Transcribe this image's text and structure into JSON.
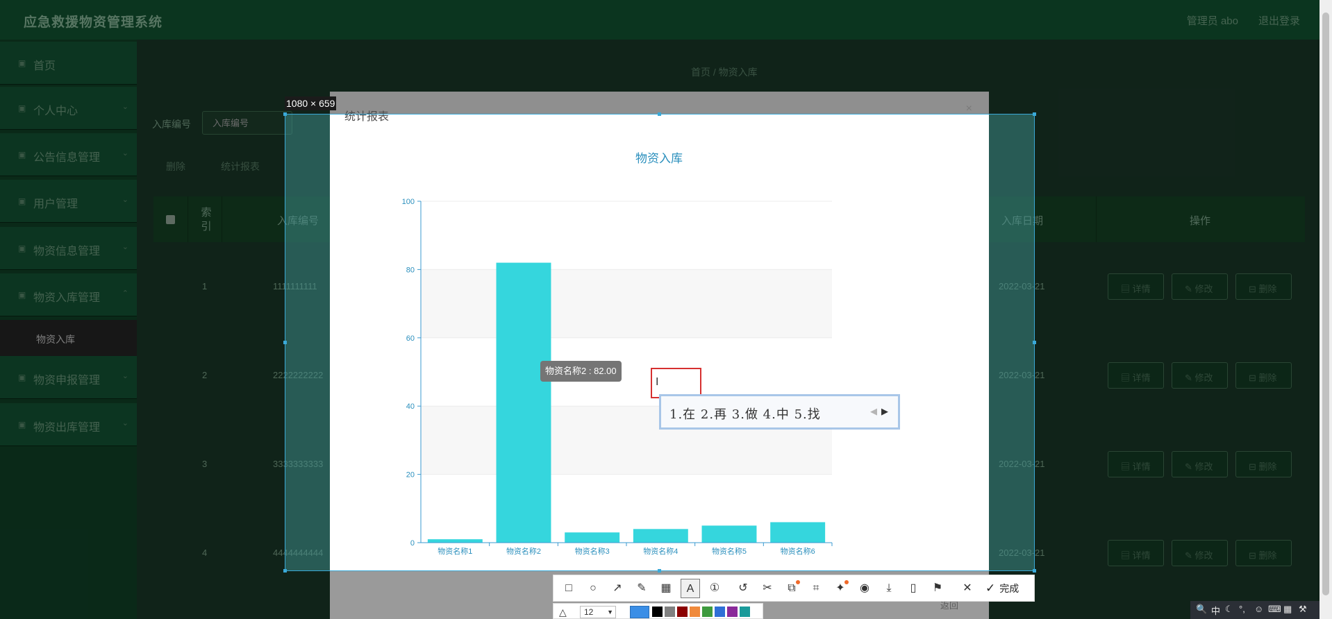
{
  "app": {
    "title": "应急救援物资管理系统",
    "user": "管理员 abo",
    "logout": "退出登录"
  },
  "sidebar": {
    "items": [
      {
        "label": "首页",
        "icon": "home-icon"
      },
      {
        "label": "个人中心",
        "icon": "user-icon"
      },
      {
        "label": "公告信息管理",
        "icon": "notice-icon"
      },
      {
        "label": "用户管理",
        "icon": "users-icon"
      },
      {
        "label": "物资信息管理",
        "icon": "box-icon"
      },
      {
        "label": "物资入库管理",
        "icon": "inbound-icon"
      },
      {
        "label": "物资申报管理",
        "icon": "apply-icon"
      },
      {
        "label": "物资出库管理",
        "icon": "outbound-icon"
      }
    ],
    "active_sub": "物资入库"
  },
  "breadcrumb": "首页 / 物资入库",
  "search": {
    "label": "入库编号",
    "placeholder": "入库编号"
  },
  "actions": {
    "delete": "删除",
    "stats": "统计报表"
  },
  "table": {
    "headers": {
      "index": "索引",
      "code": "入库编号",
      "date": "入库日期",
      "ops": "操作"
    },
    "rows": [
      {
        "index": "1",
        "code": "1111111111",
        "date": "2022-03-21"
      },
      {
        "index": "2",
        "code": "2222222222",
        "date": "2022-03-21"
      },
      {
        "index": "3",
        "code": "3333333333",
        "date": "2022-03-21"
      },
      {
        "index": "4",
        "code": "4444444444",
        "date": "2022-03-21"
      }
    ],
    "op_labels": {
      "detail": "详情",
      "edit": "修改",
      "remove": "删除"
    }
  },
  "modal": {
    "title": "统计报表",
    "close": "×",
    "return": "返回"
  },
  "capture": {
    "size_label": "1080 × 659",
    "done": "完成",
    "font_size": "12",
    "accent": "#3aa9d8",
    "current_color": "#3a8ee6",
    "swatches": [
      "#000000",
      "#808080",
      "#8b0000",
      "#f08a3c",
      "#3e9a3e",
      "#2f6fd6",
      "#8a2a9a",
      "#1a9a9a"
    ]
  },
  "chart_data": {
    "type": "bar",
    "title": "物资入库",
    "categories": [
      "物资名称1",
      "物资名称2",
      "物资名称3",
      "物资名称4",
      "物资名称5",
      "物资名称6"
    ],
    "values": [
      1,
      82,
      3,
      4,
      5,
      6
    ],
    "ylim": [
      0,
      100
    ],
    "yticks": [
      "0",
      "20",
      "40",
      "60",
      "80",
      "100"
    ],
    "bar_color": "#35d6dd",
    "tooltip": "物资名称2 : 82.00"
  },
  "ime": {
    "candidates": "1.在  2.再  3.做  4.中  5.找"
  },
  "tray": {
    "lang": "中"
  }
}
